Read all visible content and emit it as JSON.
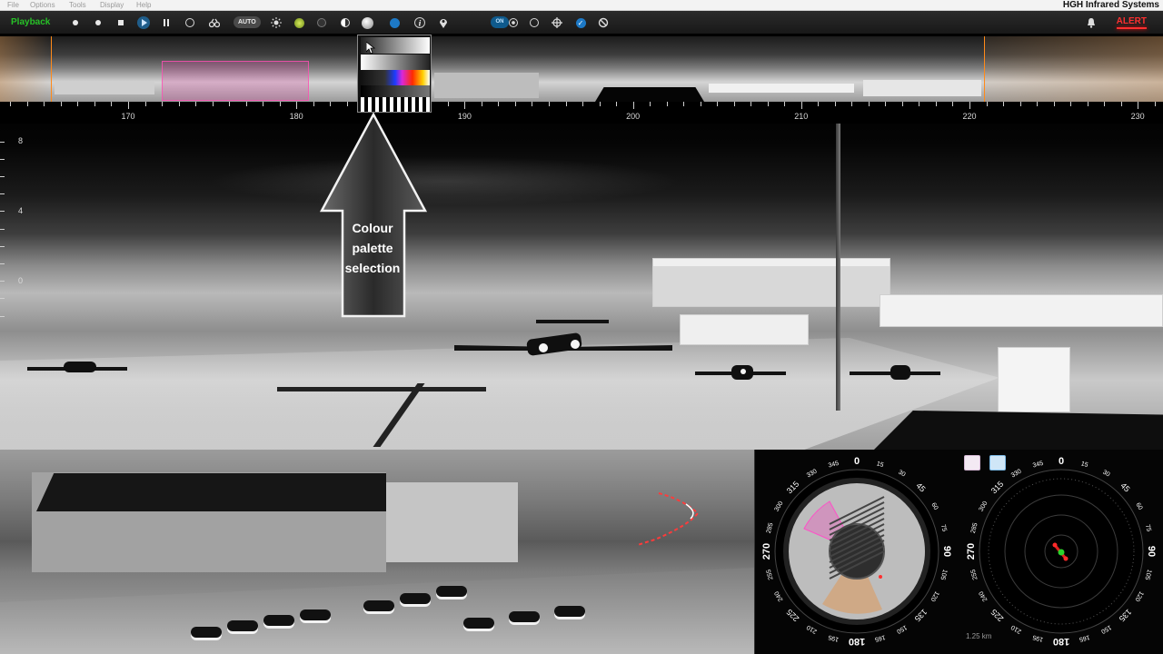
{
  "menu": {
    "items": [
      {
        "label": "File"
      },
      {
        "label": "Options"
      },
      {
        "label": "Tools"
      },
      {
        "label": "Display"
      },
      {
        "label": "Help"
      }
    ],
    "brand": "HGH Infrared Systems"
  },
  "toolbar": {
    "mode_label": "Playback",
    "auto_label": "AUTO",
    "on_label": "ON",
    "alert_label": "ALERT",
    "colors": {
      "mode": "#27c127",
      "alert": "#ff2f2f",
      "accent": "#1f5d8a"
    }
  },
  "panorama": {
    "scale_labels": [
      "170",
      "180",
      "190",
      "200",
      "210",
      "220",
      "230"
    ]
  },
  "main_view": {
    "elevation_labels": [
      "8",
      "4",
      "0"
    ]
  },
  "palette_popup": {
    "options": [
      "grayscale-white-hot",
      "grayscale-black-hot",
      "rainbow",
      "low-contrast",
      "stripes"
    ]
  },
  "annotation": {
    "text_lines": [
      "Colour",
      "palette",
      "selection"
    ]
  },
  "radar": {
    "left_dial": {
      "labels": [
        "0",
        "15",
        "30",
        "45",
        "60",
        "75",
        "90",
        "105",
        "120",
        "135",
        "150",
        "165",
        "180",
        "195",
        "210",
        "225",
        "240",
        "255",
        "270",
        "285",
        "300",
        "315",
        "330",
        "345"
      ]
    },
    "right_dial": {
      "labels": [
        "0",
        "15",
        "30",
        "45",
        "60",
        "75",
        "90",
        "105",
        "120",
        "135",
        "150",
        "165",
        "180",
        "195",
        "210",
        "225",
        "240",
        "255",
        "270",
        "285",
        "300",
        "315",
        "330",
        "345"
      ]
    },
    "range_label": "1.25 km"
  }
}
